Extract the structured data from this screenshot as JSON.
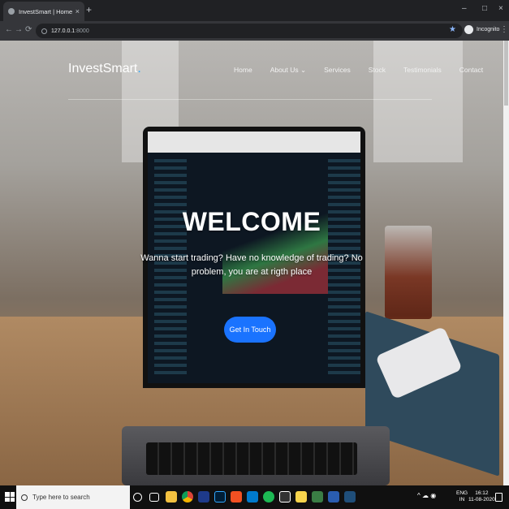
{
  "browser": {
    "tab_title": "InvestSmart | Home",
    "tab_close": "×",
    "new_tab": "+",
    "url_host": "127.0.0.1",
    "url_port": ":8000",
    "incognito_label": "Incognito",
    "back": "←",
    "forward": "→",
    "reload": "⟳",
    "star": "★",
    "menu": "⋮",
    "minimize": "–",
    "maximize": "□",
    "close": "×"
  },
  "site": {
    "logo_text": "InvestSmart",
    "logo_dot": ".",
    "nav": [
      "Home",
      "About Us ⌄",
      "Services",
      "Stock",
      "Testimonials",
      "Contact"
    ],
    "hero_title": "WELCOME",
    "hero_tagline": "Wanna start trading? Have no knowledge of trading? No problem, you are at rigth place",
    "cta_label": "Get In Touch"
  },
  "taskbar": {
    "search_placeholder": "Type here to search",
    "lang": "ENG",
    "region": "IN",
    "time": "16:12",
    "date": "11-08-2020",
    "icons": [
      "cortana-icon",
      "task-view-icon",
      "file-explorer-icon",
      "chrome-icon",
      "powershell-icon",
      "photoshop-icon",
      "app-icon",
      "vscode-icon",
      "spotify-icon",
      "terminal-icon",
      "sticky-notes-icon",
      "phone-icon",
      "powershell-icon",
      "calculator-icon"
    ]
  },
  "colors": {
    "accent": "#1a73ff",
    "logo_dot": "#2ea8ff"
  }
}
